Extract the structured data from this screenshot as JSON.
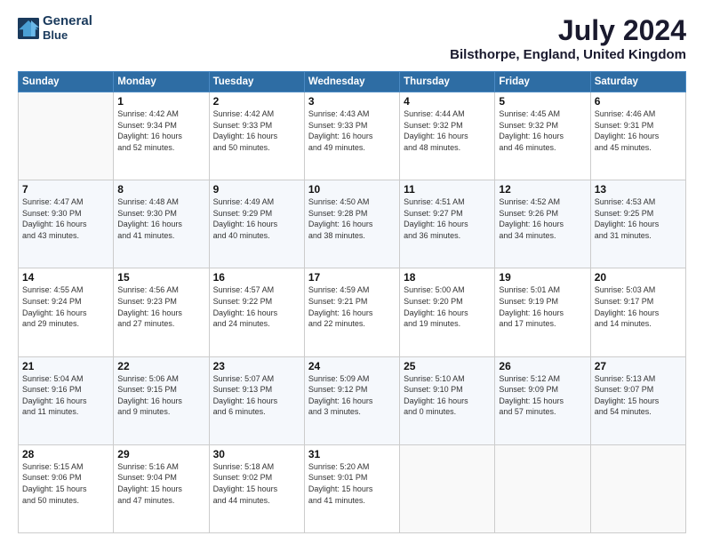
{
  "logo": {
    "line1": "General",
    "line2": "Blue"
  },
  "title": "July 2024",
  "subtitle": "Bilsthorpe, England, United Kingdom",
  "weekdays": [
    "Sunday",
    "Monday",
    "Tuesday",
    "Wednesday",
    "Thursday",
    "Friday",
    "Saturday"
  ],
  "weeks": [
    [
      {
        "day": "",
        "info": ""
      },
      {
        "day": "1",
        "info": "Sunrise: 4:42 AM\nSunset: 9:34 PM\nDaylight: 16 hours\nand 52 minutes."
      },
      {
        "day": "2",
        "info": "Sunrise: 4:42 AM\nSunset: 9:33 PM\nDaylight: 16 hours\nand 50 minutes."
      },
      {
        "day": "3",
        "info": "Sunrise: 4:43 AM\nSunset: 9:33 PM\nDaylight: 16 hours\nand 49 minutes."
      },
      {
        "day": "4",
        "info": "Sunrise: 4:44 AM\nSunset: 9:32 PM\nDaylight: 16 hours\nand 48 minutes."
      },
      {
        "day": "5",
        "info": "Sunrise: 4:45 AM\nSunset: 9:32 PM\nDaylight: 16 hours\nand 46 minutes."
      },
      {
        "day": "6",
        "info": "Sunrise: 4:46 AM\nSunset: 9:31 PM\nDaylight: 16 hours\nand 45 minutes."
      }
    ],
    [
      {
        "day": "7",
        "info": "Sunrise: 4:47 AM\nSunset: 9:30 PM\nDaylight: 16 hours\nand 43 minutes."
      },
      {
        "day": "8",
        "info": "Sunrise: 4:48 AM\nSunset: 9:30 PM\nDaylight: 16 hours\nand 41 minutes."
      },
      {
        "day": "9",
        "info": "Sunrise: 4:49 AM\nSunset: 9:29 PM\nDaylight: 16 hours\nand 40 minutes."
      },
      {
        "day": "10",
        "info": "Sunrise: 4:50 AM\nSunset: 9:28 PM\nDaylight: 16 hours\nand 38 minutes."
      },
      {
        "day": "11",
        "info": "Sunrise: 4:51 AM\nSunset: 9:27 PM\nDaylight: 16 hours\nand 36 minutes."
      },
      {
        "day": "12",
        "info": "Sunrise: 4:52 AM\nSunset: 9:26 PM\nDaylight: 16 hours\nand 34 minutes."
      },
      {
        "day": "13",
        "info": "Sunrise: 4:53 AM\nSunset: 9:25 PM\nDaylight: 16 hours\nand 31 minutes."
      }
    ],
    [
      {
        "day": "14",
        "info": "Sunrise: 4:55 AM\nSunset: 9:24 PM\nDaylight: 16 hours\nand 29 minutes."
      },
      {
        "day": "15",
        "info": "Sunrise: 4:56 AM\nSunset: 9:23 PM\nDaylight: 16 hours\nand 27 minutes."
      },
      {
        "day": "16",
        "info": "Sunrise: 4:57 AM\nSunset: 9:22 PM\nDaylight: 16 hours\nand 24 minutes."
      },
      {
        "day": "17",
        "info": "Sunrise: 4:59 AM\nSunset: 9:21 PM\nDaylight: 16 hours\nand 22 minutes."
      },
      {
        "day": "18",
        "info": "Sunrise: 5:00 AM\nSunset: 9:20 PM\nDaylight: 16 hours\nand 19 minutes."
      },
      {
        "day": "19",
        "info": "Sunrise: 5:01 AM\nSunset: 9:19 PM\nDaylight: 16 hours\nand 17 minutes."
      },
      {
        "day": "20",
        "info": "Sunrise: 5:03 AM\nSunset: 9:17 PM\nDaylight: 16 hours\nand 14 minutes."
      }
    ],
    [
      {
        "day": "21",
        "info": "Sunrise: 5:04 AM\nSunset: 9:16 PM\nDaylight: 16 hours\nand 11 minutes."
      },
      {
        "day": "22",
        "info": "Sunrise: 5:06 AM\nSunset: 9:15 PM\nDaylight: 16 hours\nand 9 minutes."
      },
      {
        "day": "23",
        "info": "Sunrise: 5:07 AM\nSunset: 9:13 PM\nDaylight: 16 hours\nand 6 minutes."
      },
      {
        "day": "24",
        "info": "Sunrise: 5:09 AM\nSunset: 9:12 PM\nDaylight: 16 hours\nand 3 minutes."
      },
      {
        "day": "25",
        "info": "Sunrise: 5:10 AM\nSunset: 9:10 PM\nDaylight: 16 hours\nand 0 minutes."
      },
      {
        "day": "26",
        "info": "Sunrise: 5:12 AM\nSunset: 9:09 PM\nDaylight: 15 hours\nand 57 minutes."
      },
      {
        "day": "27",
        "info": "Sunrise: 5:13 AM\nSunset: 9:07 PM\nDaylight: 15 hours\nand 54 minutes."
      }
    ],
    [
      {
        "day": "28",
        "info": "Sunrise: 5:15 AM\nSunset: 9:06 PM\nDaylight: 15 hours\nand 50 minutes."
      },
      {
        "day": "29",
        "info": "Sunrise: 5:16 AM\nSunset: 9:04 PM\nDaylight: 15 hours\nand 47 minutes."
      },
      {
        "day": "30",
        "info": "Sunrise: 5:18 AM\nSunset: 9:02 PM\nDaylight: 15 hours\nand 44 minutes."
      },
      {
        "day": "31",
        "info": "Sunrise: 5:20 AM\nSunset: 9:01 PM\nDaylight: 15 hours\nand 41 minutes."
      },
      {
        "day": "",
        "info": ""
      },
      {
        "day": "",
        "info": ""
      },
      {
        "day": "",
        "info": ""
      }
    ]
  ]
}
